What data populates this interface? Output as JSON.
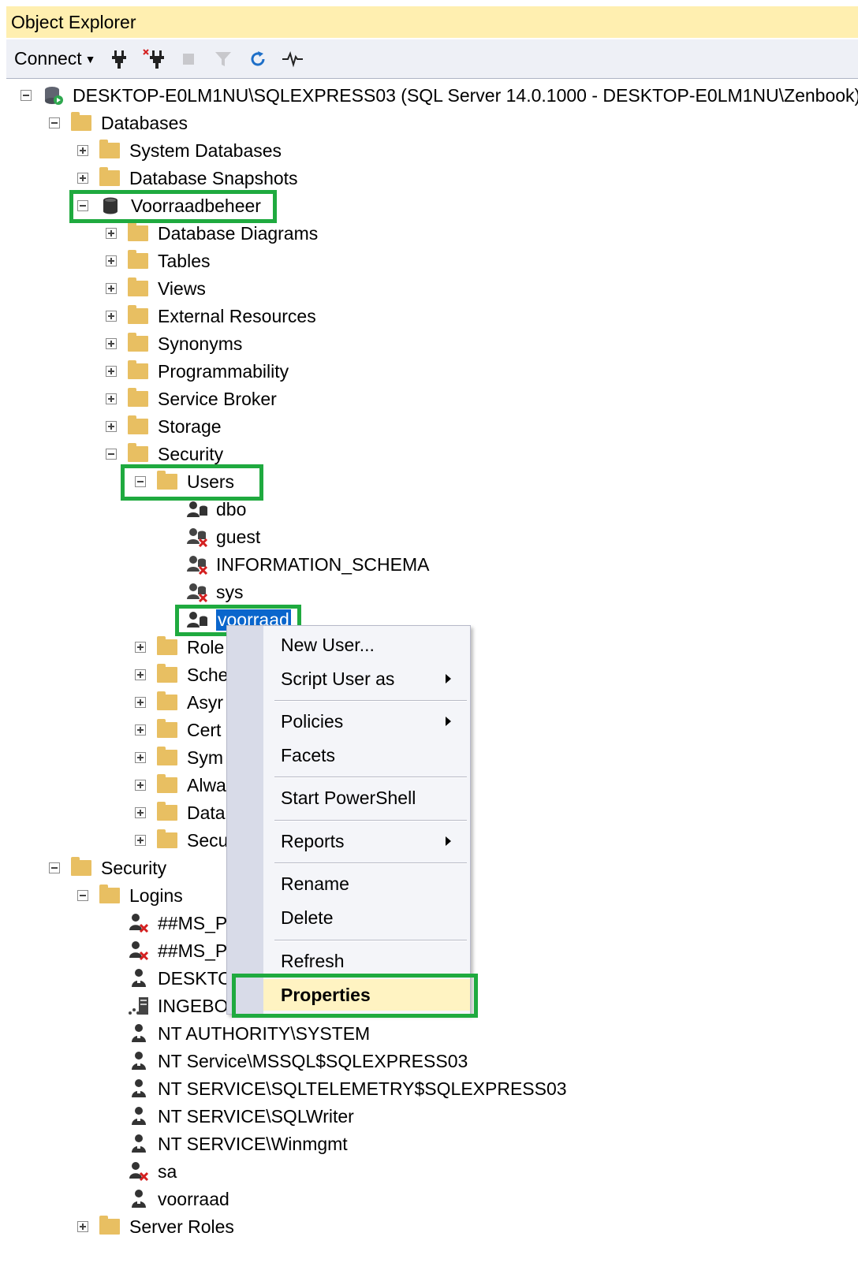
{
  "panel": {
    "title": "Object Explorer"
  },
  "toolbar": {
    "connect_label": "Connect",
    "icons": [
      "connect-plug-icon",
      "disconnect-plug-icon",
      "stop-icon",
      "filter-icon",
      "refresh-icon",
      "activity-monitor-icon"
    ]
  },
  "colors": {
    "selection": "#0a66cc",
    "highlight_box": "#1faa3f",
    "title_bg": "#ffefb0",
    "folder": "#e8bf62"
  },
  "tree": {
    "server": "DESKTOP-E0LM1NU\\SQLEXPRESS03 (SQL Server 14.0.1000 - DESKTOP-E0LM1NU\\Zenbook)",
    "databases": "Databases",
    "system_databases": "System Databases",
    "database_snapshots": "Database Snapshots",
    "voorraadbeheer": "Voorraadbeheer",
    "db_children": [
      "Database Diagrams",
      "Tables",
      "Views",
      "External Resources",
      "Synonyms",
      "Programmability",
      "Service Broker",
      "Storage"
    ],
    "db_security": "Security",
    "users": "Users",
    "user_items": [
      "dbo",
      "guest",
      "INFORMATION_SCHEMA",
      "sys",
      "voorraad"
    ],
    "security_children": [
      "Role",
      "Sche",
      "Asyr",
      "Cert",
      "Sym",
      "Alwa",
      "Data",
      "Secu"
    ],
    "server_security": "Security",
    "logins": "Logins",
    "login_items": [
      "##MS_P",
      "##MS_P",
      "DESKTO",
      "INGEBO",
      "NT AUTHORITY\\SYSTEM",
      "NT Service\\MSSQL$SQLEXPRESS03",
      "NT SERVICE\\SQLTELEMETRY$SQLEXPRESS03",
      "NT SERVICE\\SQLWriter",
      "NT SERVICE\\Winmgmt",
      "sa",
      "voorraad"
    ],
    "server_roles": "Server Roles"
  },
  "context_menu": {
    "new_user": "New User...",
    "script_user_as": "Script User as",
    "policies": "Policies",
    "facets": "Facets",
    "start_powershell": "Start PowerShell",
    "reports": "Reports",
    "rename": "Rename",
    "delete": "Delete",
    "refresh": "Refresh",
    "properties": "Properties"
  }
}
